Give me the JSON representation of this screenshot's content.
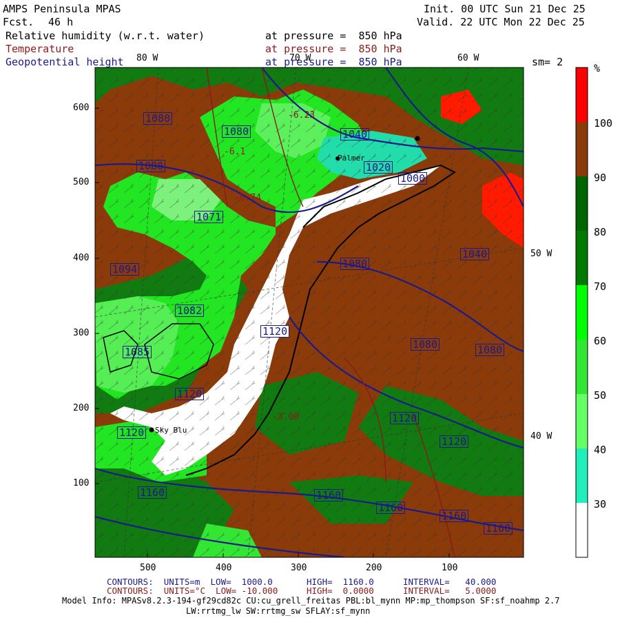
{
  "header": {
    "model": "AMPS Peninsula MPAS",
    "fcst_label": "Fcst.",
    "fcst_value": "46 h",
    "init": "Init. 00 UTC Sun 21 Dec 25",
    "valid": "Valid. 22 UTC Mon 22 Dec 25",
    "field1": "Relative humidity (w.r.t. water)",
    "field2": "Temperature",
    "field3": "Geopotential height",
    "pressure1": "at pressure =  850 hPa",
    "pressure2": "at pressure =  850 hPa",
    "pressure3": "at pressure =  850 hPa",
    "smoothing": "sm= 2"
  },
  "colorbar": {
    "unit": "%",
    "labels": [
      "100",
      "90",
      "80",
      "70",
      "60",
      "50",
      "40",
      "30"
    ],
    "colors": [
      "#ff0000",
      "#8b3a0a",
      "#006400",
      "#007a00",
      "#00ff00",
      "#33e633",
      "#66ff66",
      "#22eebb",
      "#ffffff"
    ]
  },
  "axes": {
    "y_ticks": [
      "600",
      "500",
      "400",
      "300",
      "200",
      "100"
    ],
    "x_ticks": [
      "500",
      "400",
      "300",
      "200",
      "100"
    ],
    "lon_labels": [
      "80 W",
      "70 W",
      "60 W",
      "50 W",
      "40 W"
    ]
  },
  "map_labels": {
    "place1": "Palmer",
    "place2": "Sky Blu",
    "height_labels": [
      "1080",
      "1080",
      "1080",
      "1040",
      "1020",
      "1000",
      "1071",
      "1094",
      "1082",
      "1085",
      "1120",
      "1120",
      "1080",
      "1040",
      "1080",
      "1080",
      "1120",
      "1120",
      "1160",
      "1160",
      "1160",
      "1160",
      "1160",
      "1120"
    ],
    "temp_labels": [
      "-6.23",
      "-6.1",
      "-6.74",
      "-3.00"
    ]
  },
  "footer": {
    "line1_a": "CONTOURS:  UNITS=m  LOW=  1000.0",
    "line1_b": "HIGH=  1160.0",
    "line1_c": "INTERVAL=   40.000",
    "line2_a": "CONTOURS:  UNITS=°C  LOW= -10.000",
    "line2_b": "HIGH=  0.0000",
    "line2_c": "INTERVAL=   5.0000",
    "model_info": "Model Info: MPASv8.2.3-194-gf29cd82c CU:cu_grell_freitas PBL:bl_mynn MP:mp_thompson SF:sf_noahmp 2.7",
    "model_info2": "LW:rrtmg_lw SW:rrtmg_sw SFLAY:sf_mynn"
  }
}
